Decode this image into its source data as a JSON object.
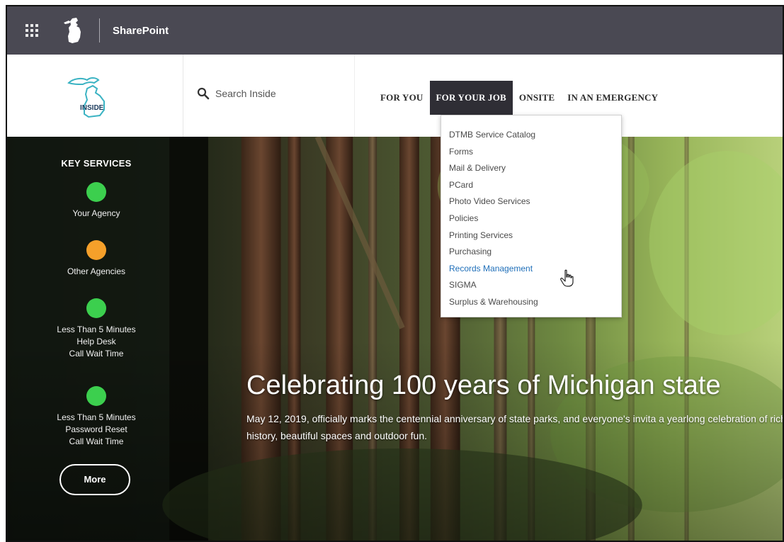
{
  "suite_bar": {
    "app_name": "SharePoint",
    "waffle_icon": "app-launcher-icon"
  },
  "site_header": {
    "logo_text": "INSIDE",
    "search_placeholder": "Search Inside",
    "nav": [
      {
        "label": "FOR YOU",
        "active": false
      },
      {
        "label": "FOR YOUR JOB",
        "active": true
      },
      {
        "label": "ONSITE",
        "active": false
      },
      {
        "label": "IN AN EMERGENCY",
        "active": false
      }
    ]
  },
  "dropdown": {
    "items": [
      "DTMB Service Catalog",
      "Forms",
      "Mail & Delivery",
      "PCard",
      "Photo Video Services",
      "Policies",
      "Printing Services",
      "Purchasing",
      "Records Management",
      "SIGMA",
      "Surplus & Warehousing"
    ],
    "hovered_index": 8
  },
  "key_services": {
    "title": "KEY SERVICES",
    "items": [
      {
        "label": "Your Agency",
        "status_color": "#3ccf4e"
      },
      {
        "label": "Other Agencies",
        "status_color": "#f5a02a"
      },
      {
        "label": "Less Than 5 Minutes\nHelp Desk\nCall Wait Time",
        "status_color": "#3ccf4e"
      },
      {
        "label": "Less Than 5 Minutes\nPassword Reset\nCall Wait Time",
        "status_color": "#3ccf4e"
      }
    ],
    "more_label": "More"
  },
  "hero": {
    "heading": "Celebrating 100 years of Michigan state",
    "subtext": "May 12, 2019, officially marks the centennial anniversary of state parks, and everyone's invita a yearlong celebration of rich history, beautiful spaces and outdoor fun."
  },
  "colors": {
    "suite_bar": "#4a4953",
    "nav_active_bg": "#2f2e35",
    "link_hover": "#1f6fb9"
  }
}
